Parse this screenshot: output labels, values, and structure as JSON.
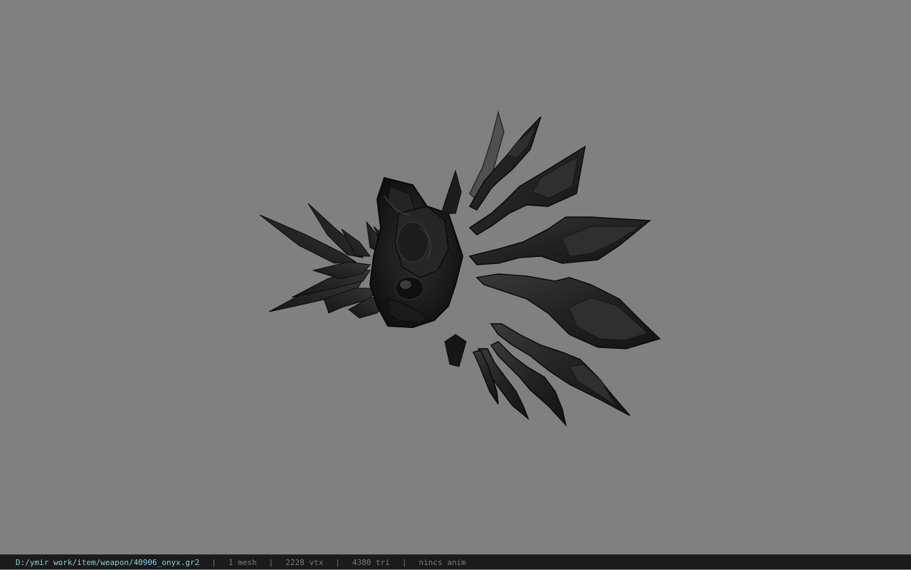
{
  "viewer": {
    "background_color": "#808080",
    "model": {
      "description_icon": "onyx-claw-weapon-model",
      "base_color": "#1e1e1e",
      "highlight_color": "#3a3a3a"
    }
  },
  "status_bar": {
    "file_path": "D:/ymir work/item/weapon/40906_onyx.gr2",
    "separator": "|",
    "mesh_count": "1 mesh",
    "vertex_count": "2228 vtx",
    "triangle_count": "4380 tri",
    "animation": "nincs anim",
    "path_color": "#7fd3ea",
    "text_color": "#7b7b7b",
    "background_color": "#1b1b1b"
  }
}
